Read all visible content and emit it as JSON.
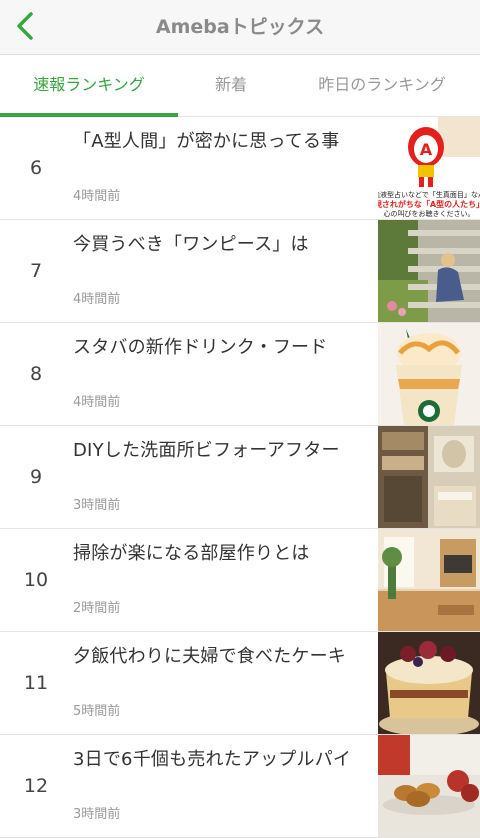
{
  "header": {
    "title": "Amebaトピックス",
    "back_icon": "chevron-left-icon",
    "accent_color": "#35a640"
  },
  "tabs": [
    {
      "label": "速報ランキング",
      "active": true
    },
    {
      "label": "新着",
      "active": false
    },
    {
      "label": "昨日のランキング",
      "active": false
    }
  ],
  "items": [
    {
      "rank": "6",
      "title": "「A型人間」が密かに思ってる事",
      "time": "4時間前",
      "thumb_lines": [
        "血液型占いなどで「生真面目」なん",
        "現されがちな「A型の人たち」",
        "心の叫びをお聴きください。"
      ]
    },
    {
      "rank": "7",
      "title": "今買うべき「ワンピース」は",
      "time": "4時間前"
    },
    {
      "rank": "8",
      "title": "スタバの新作ドリンク・フード",
      "time": "4時間前"
    },
    {
      "rank": "9",
      "title": "DIYした洗面所ビフォーアフター",
      "time": "3時間前"
    },
    {
      "rank": "10",
      "title": "掃除が楽になる部屋作りとは",
      "time": "2時間前"
    },
    {
      "rank": "11",
      "title": "夕飯代わりに夫婦で食べたケーキ",
      "time": "5時間前"
    },
    {
      "rank": "12",
      "title": "3日で6千個も売れたアップルパイ",
      "time": "3時間前"
    }
  ]
}
